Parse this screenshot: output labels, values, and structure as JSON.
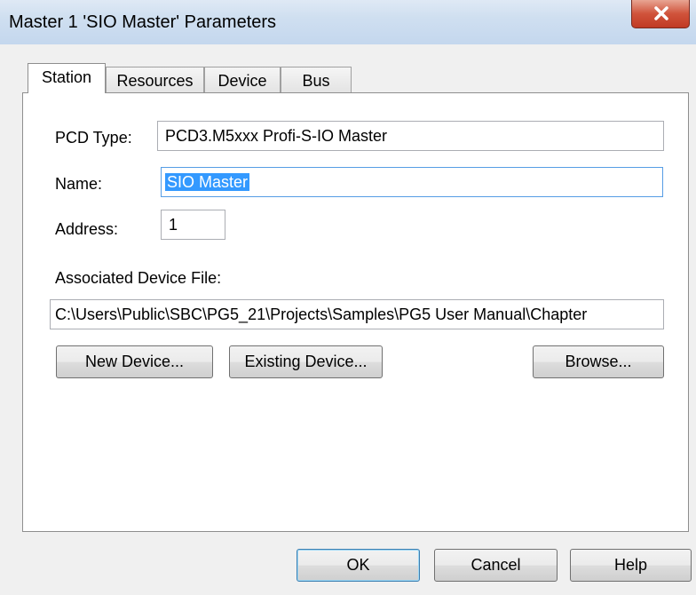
{
  "window": {
    "title": "Master 1 'SIO Master' Parameters",
    "close_icon": "close-icon"
  },
  "tabs": [
    {
      "label": "Station",
      "active": true
    },
    {
      "label": "Resources",
      "active": false
    },
    {
      "label": "Device",
      "active": false
    },
    {
      "label": "Bus",
      "active": false
    }
  ],
  "station": {
    "pcd_type_label": "PCD Type:",
    "pcd_type_value": "PCD3.M5xxx Profi-S-IO Master",
    "name_label": "Name:",
    "name_value": "SIO Master",
    "address_label": "Address:",
    "address_value": "1",
    "device_file_label": "Associated Device File:",
    "device_file_value": "C:\\Users\\Public\\SBC\\PG5_21\\Projects\\Samples\\PG5 User Manual\\Chapter",
    "new_device_label": "New Device...",
    "existing_device_label": "Existing Device...",
    "browse_label": "Browse..."
  },
  "footer": {
    "ok_label": "OK",
    "cancel_label": "Cancel",
    "help_label": "Help"
  },
  "colors": {
    "selection": "#3399ff",
    "close_button": "#c9472f"
  }
}
